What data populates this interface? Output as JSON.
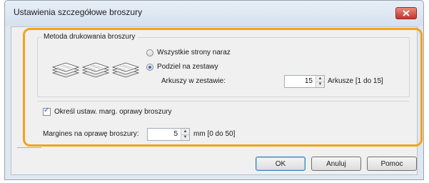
{
  "window": {
    "title": "Ustawienia szczegółowe broszury"
  },
  "group": {
    "title": "Metoda drukowania broszury",
    "options": [
      {
        "label": "Wszystkie strony naraz",
        "selected": false
      },
      {
        "label": "Podziel na zestawy",
        "selected": true
      }
    ],
    "sheets_label": "Arkuszy w zestawie:",
    "sheets_value": "15",
    "sheets_unit": "Arkusze [1 do 15]"
  },
  "binding_margin": {
    "checkbox_label": "Określ ustaw. marg. oprawy broszury",
    "checked": true,
    "margin_label": "Margines na oprawę broszury:",
    "margin_value": "5",
    "margin_unit": "mm [0 do 50]"
  },
  "buttons": {
    "ok": "OK",
    "cancel": "Anuluj",
    "help": "Pomoc"
  },
  "icons": [
    "booklet-stack-icon",
    "booklet-stack-icon",
    "booklet-stack-icon",
    "close-icon"
  ],
  "colors": {
    "highlight": "#f5a21a",
    "close": "#c2352a"
  }
}
